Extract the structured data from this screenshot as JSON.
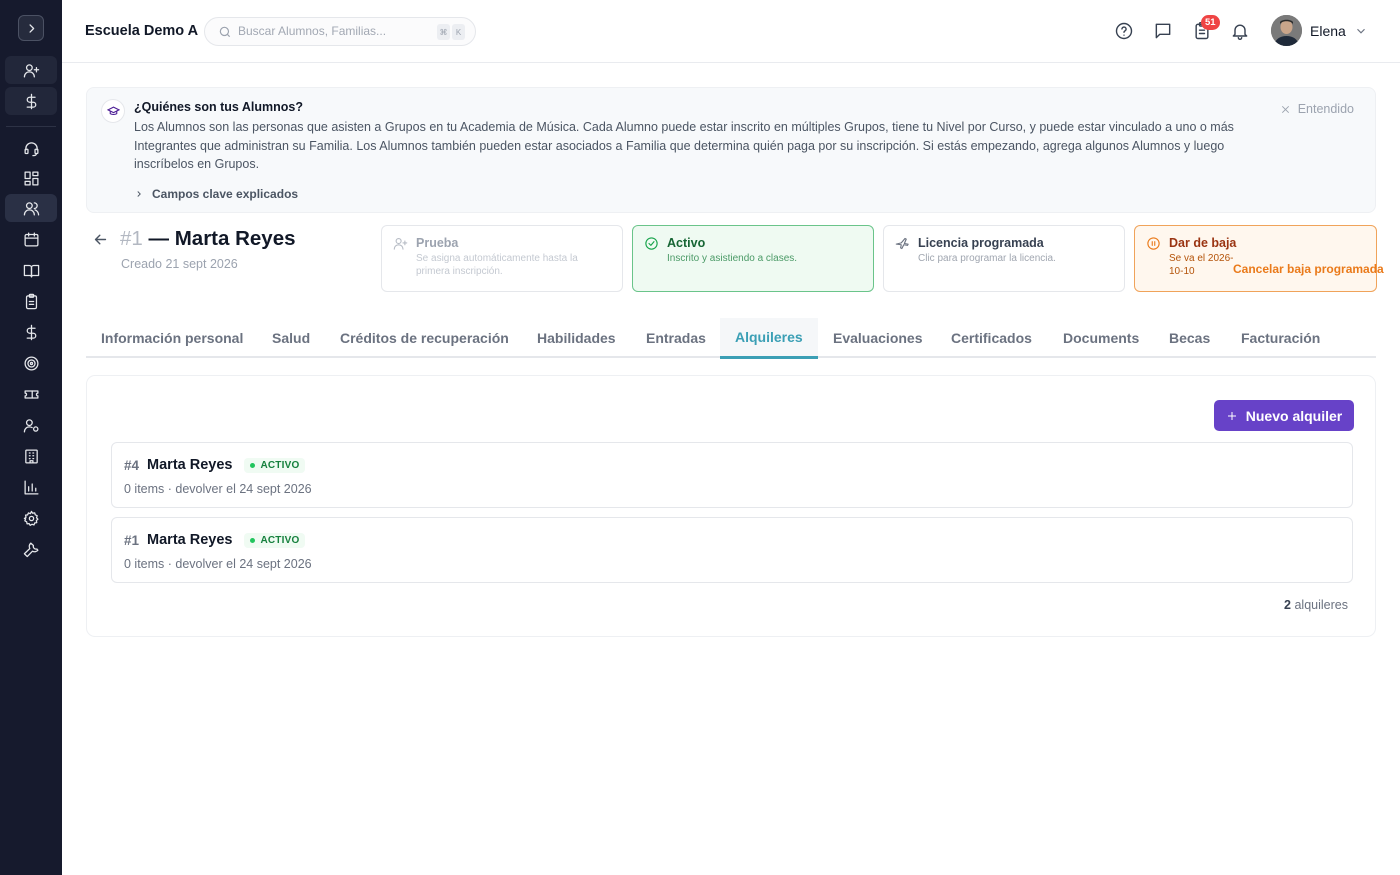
{
  "header": {
    "school_name": "Escuela Demo A",
    "search_placeholder": "Buscar Alumnos, Familias...",
    "shortcut_keys": [
      "⌘",
      "K"
    ],
    "notification_count": "51",
    "user_name": "Elena"
  },
  "sidebar": {
    "items": [
      {
        "icon": "user-plus-icon"
      },
      {
        "icon": "dollar-icon"
      },
      {
        "icon": "headset-icon"
      },
      {
        "icon": "dashboard-icon"
      },
      {
        "icon": "users-icon"
      },
      {
        "icon": "calendar-icon"
      },
      {
        "icon": "book-icon"
      },
      {
        "icon": "clipboard-icon"
      },
      {
        "icon": "dollar-icon"
      },
      {
        "icon": "target-icon"
      },
      {
        "icon": "ticket-icon"
      },
      {
        "icon": "user-settings-icon"
      },
      {
        "icon": "building-icon"
      },
      {
        "icon": "bar-chart-icon"
      },
      {
        "icon": "gear-icon"
      },
      {
        "icon": "wrench-icon"
      }
    ]
  },
  "info_banner": {
    "title": "¿Quiénes son tus Alumnos?",
    "body": "Los Alumnos son las personas que asisten a Grupos en tu Academia de Música. Cada Alumno puede estar inscrito en múltiples Grupos, tiene tu Nivel por Curso, y puede estar vinculado a uno o más Integrantes que administran su Familia. Los Alumnos también pueden estar asociados a Familia que determina quién paga por su inscripción. Si estás empezando, agrega algunos Alumnos y luego inscríbelos en Grupos.",
    "dismiss_label": "Entendido",
    "more_label": "Campos clave explicados"
  },
  "student": {
    "number": "#1",
    "name": "— Marta Reyes",
    "created": "Creado 21 sept 2026"
  },
  "status_cards": {
    "trial": {
      "title": "Prueba",
      "desc": "Se asigna automáticamente hasta la primera inscripción."
    },
    "active": {
      "title": "Activo",
      "desc": "Inscrito y asistiendo a clases."
    },
    "leave": {
      "title": "Licencia programada",
      "desc": "Clic para programar la licencia."
    },
    "drop": {
      "title": "Dar de baja",
      "desc": "Se va el 2026-10-10",
      "action": "Cancelar baja programada"
    }
  },
  "tabs": [
    "Información personal",
    "Salud",
    "Créditos de recuperación",
    "Habilidades",
    "Entradas",
    "Alquileres",
    "Evaluaciones",
    "Certificados",
    "Documents",
    "Becas",
    "Facturación"
  ],
  "active_tab": "Alquileres",
  "rentals": {
    "new_button": "Nuevo alquiler",
    "items": [
      {
        "id": "#4",
        "name": "Marta Reyes",
        "status": "ACTIVO",
        "meta": "0 items · devolver el 24 sept 2026"
      },
      {
        "id": "#1",
        "name": "Marta Reyes",
        "status": "ACTIVO",
        "meta": "0 items · devolver el 24 sept 2026"
      }
    ],
    "count": "2",
    "count_label": "alquileres"
  },
  "colors": {
    "sidebar_bg": "#161a2d",
    "accent_purple": "#6742c8",
    "active_tab": "#3b9fb5",
    "active_green": "#16a34a",
    "drop_orange": "#ea7a1a"
  }
}
